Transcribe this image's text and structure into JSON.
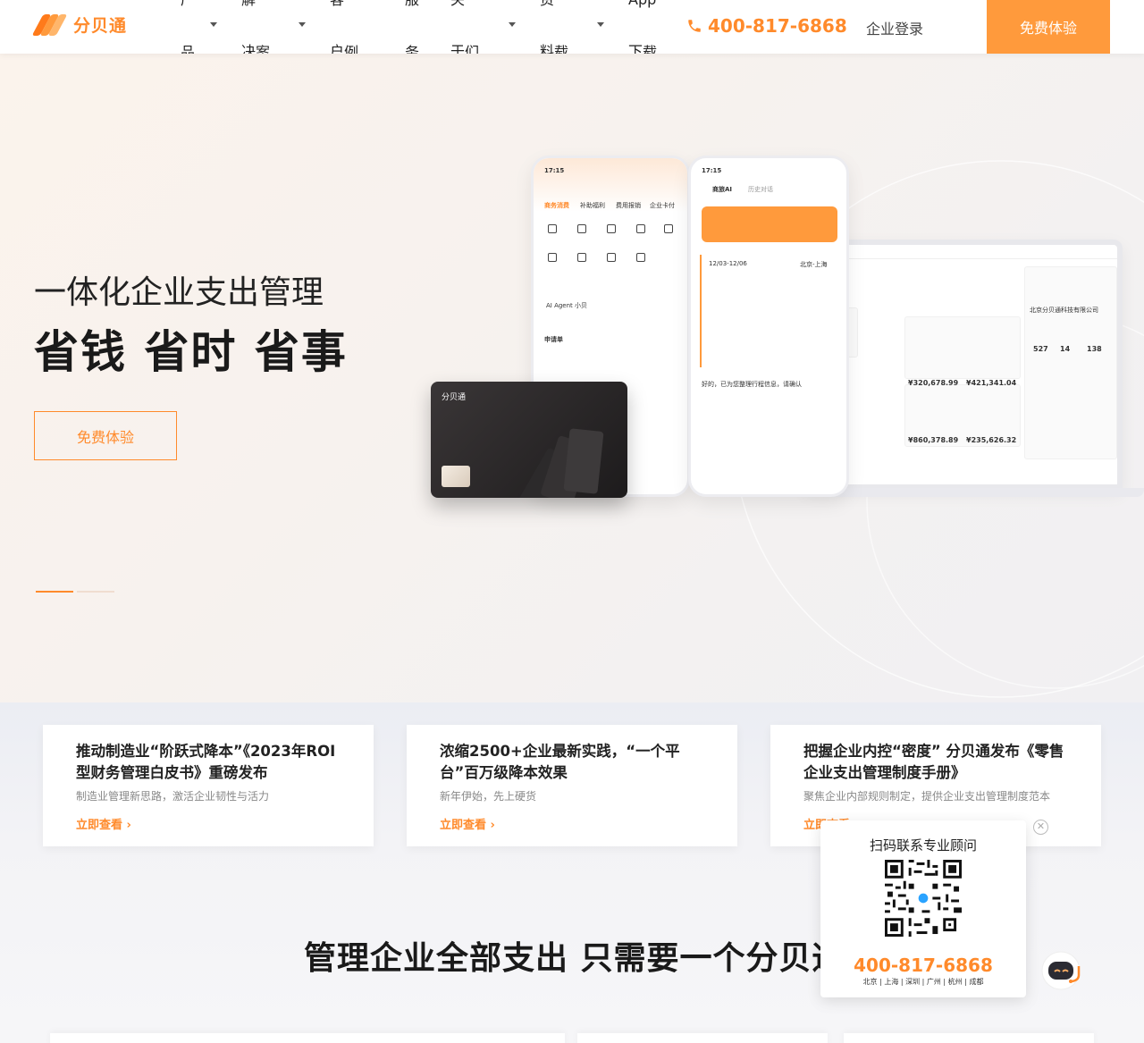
{
  "header": {
    "logo_text": "分贝通",
    "nav": [
      {
        "line1": "产",
        "line2": "品"
      },
      {
        "line1": "解决方",
        "line2": "案"
      },
      {
        "line1": "客户案",
        "line2": "例"
      },
      {
        "line1": "服",
        "line2": "务"
      },
      {
        "line1": "关于我",
        "line2": "们"
      },
      {
        "line1": "资料下",
        "line2": "载"
      },
      {
        "line1": "App下",
        "line2": "载"
      }
    ],
    "phone": "400-817-6868",
    "login": "企业登录",
    "trial": "免费体验"
  },
  "hero": {
    "subtitle": "一体化企业支出管理",
    "title": "省钱 省时 省事",
    "button": "免费体验"
  },
  "mock": {
    "time": "17:15",
    "tabs": [
      "商务消费",
      "补助福利",
      "费用报销",
      "企业卡付"
    ],
    "apply": "申请单",
    "agent": "AI Agent 小贝",
    "ai_title": "商旅AI",
    "history": "历史对话",
    "trip_date": "12/03-12/06",
    "trip_route": "北京-上海",
    "company": "北京分贝通科技有限公司",
    "amounts": [
      "¥320,678.99",
      "¥421,341.04",
      "¥860,378.89",
      "¥235,626.32"
    ],
    "stats": [
      "527",
      "14",
      "138"
    ],
    "card_brand": "分贝通",
    "confirm": "好的，已为您整理行程信息，请确认"
  },
  "news": [
    {
      "title": "推动制造业“阶跃式降本”《2023年ROI型财务管理白皮书》重磅发布",
      "desc": "制造业管理新思路，激活企业韧性与活力",
      "link": "立即查看"
    },
    {
      "title": "浓缩2500+企业最新实践，“一个平台”百万级降本效果",
      "desc": "新年伊始，先上硬货",
      "link": "立即查看"
    },
    {
      "title": "把握企业内控“密度” 分贝通发布《零售企业支出管理制度手册》",
      "desc": "聚焦企业内部规则制定，提供企业支出管理制度范本",
      "link": "立即查看"
    }
  ],
  "section_title": "管理企业全部支出  只需要一个分贝通",
  "qr": {
    "title": "扫码联系专业顾问",
    "phone": "400-817-6868",
    "cities": "北京 | 上海 | 深圳 | 广州 | 杭州 | 成都",
    "close": "✕"
  },
  "colors": {
    "accent": "#ff8a2b",
    "accent_light": "#ff9a3c"
  }
}
